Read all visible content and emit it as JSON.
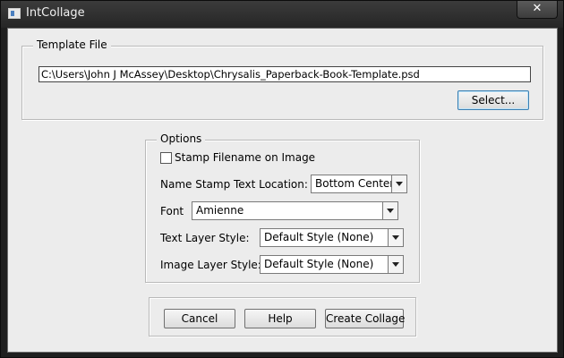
{
  "window": {
    "title": "IntCollage",
    "close_label": "✕"
  },
  "template_group": {
    "legend": "Template File",
    "path": "C:\\Users\\John J McAssey\\Desktop\\Chrysalis_Paperback-Book-Template.psd",
    "select_label": "Select..."
  },
  "options": {
    "legend": "Options",
    "stamp_label": "Stamp Filename on Image",
    "stamp_checked": false,
    "name_stamp_label": "Name Stamp Text  Location:",
    "location_value": "Bottom Center",
    "font_label": "Font",
    "font_value": "Amienne",
    "text_layer_label": "Text Layer Style:",
    "text_layer_value": "Default Style (None)",
    "image_layer_label": "Image Layer Style:",
    "image_layer_value": "Default Style (None)"
  },
  "buttons": {
    "cancel": "Cancel",
    "help": "Help",
    "create": "Create Collage"
  }
}
